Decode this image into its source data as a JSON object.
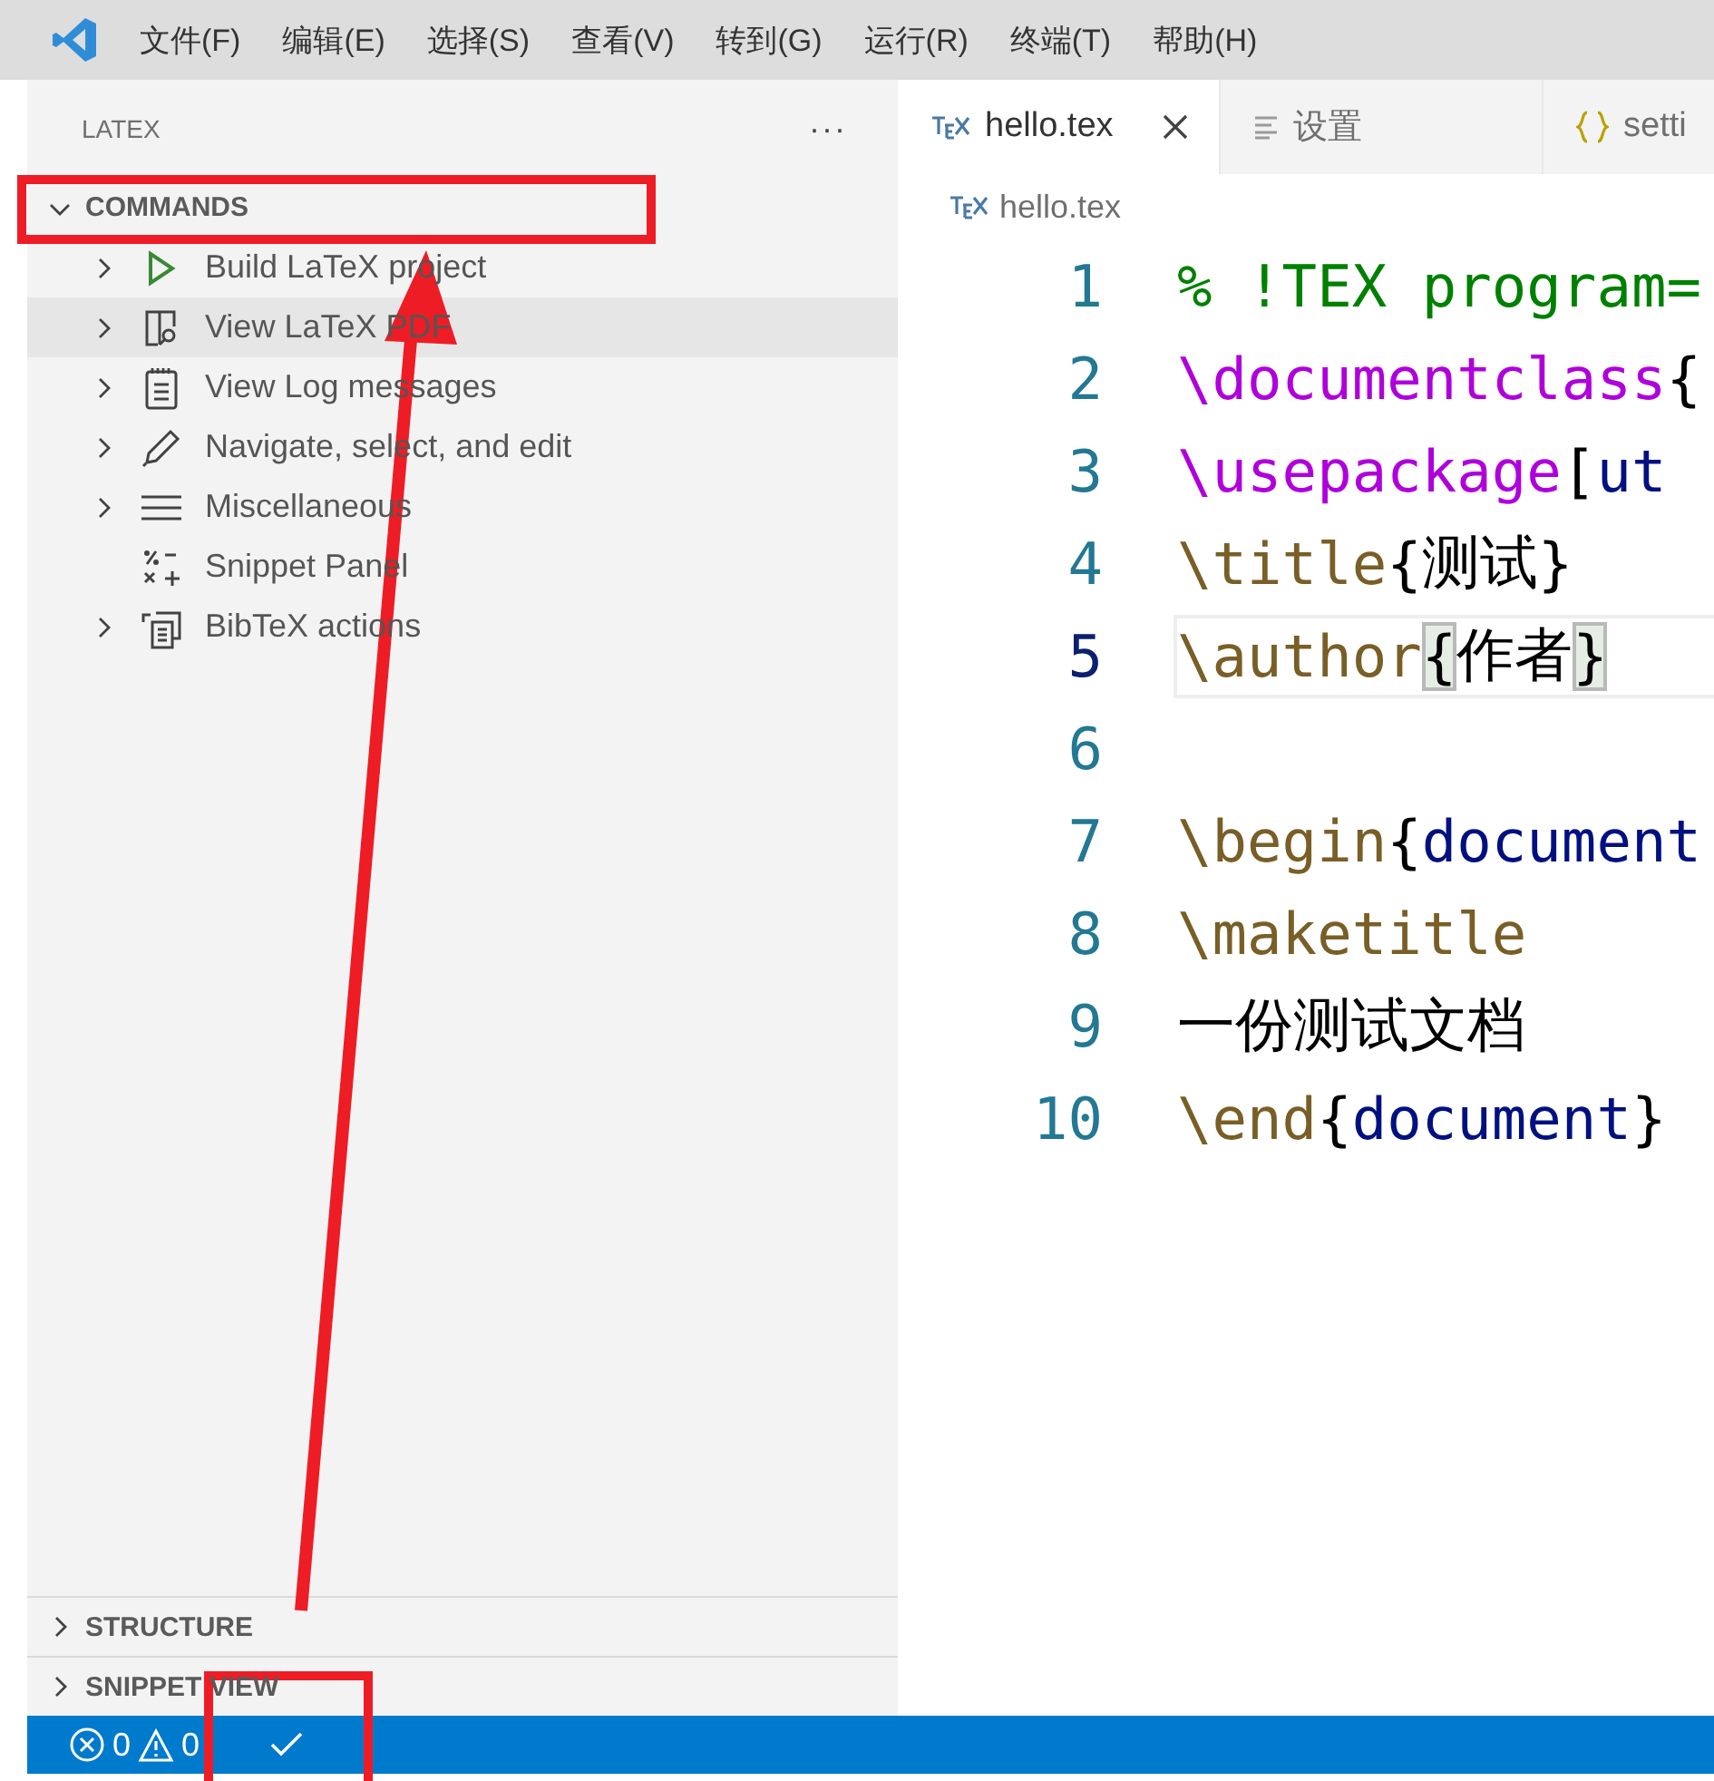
{
  "menu_bar": [
    "文件(F)",
    "编辑(E)",
    "选择(S)",
    "查看(V)",
    "转到(G)",
    "运行(R)",
    "终端(T)",
    "帮助(H)"
  ],
  "sidebar": {
    "title": "LATEX",
    "more": "···",
    "sections": [
      {
        "label": "COMMANDS",
        "expanded": true,
        "items": [
          {
            "label": "Build LaTeX project",
            "kind": "play",
            "expandable": true,
            "selected": false
          },
          {
            "label": "View LaTeX PDF",
            "kind": "pdf",
            "expandable": true,
            "selected": true
          },
          {
            "label": "View Log messages",
            "kind": "log",
            "expandable": true,
            "selected": false
          },
          {
            "label": "Navigate, select, and edit",
            "kind": "pencil",
            "expandable": true,
            "selected": false
          },
          {
            "label": "Miscellaneous",
            "kind": "lines",
            "expandable": true,
            "selected": false
          },
          {
            "label": "Snippet Panel",
            "kind": "symbols",
            "expandable": false,
            "selected": false
          },
          {
            "label": "BibTeX actions",
            "kind": "bib",
            "expandable": true,
            "selected": false
          }
        ]
      },
      {
        "label": "STRUCTURE",
        "expanded": false
      },
      {
        "label": "SNIPPET VIEW",
        "expanded": false
      }
    ]
  },
  "tabs": [
    {
      "label": "hello.tex",
      "kind": "tex",
      "selected": true
    },
    {
      "label": "设置",
      "kind": "settings",
      "selected": false
    },
    {
      "label": "setti",
      "kind": "json",
      "selected": false
    }
  ],
  "breadcrumb": "hello.tex",
  "editor": {
    "lines": [
      {
        "number": "1",
        "current": false,
        "tokens": [
          {
            "text": "% !TEX program=",
            "kind": "comment"
          }
        ]
      },
      {
        "number": "2",
        "current": false,
        "tokens": [
          {
            "text": "\\documentclass",
            "kind": "keyword"
          },
          {
            "text": "{",
            "kind": "bracket"
          }
        ]
      },
      {
        "number": "3",
        "current": false,
        "tokens": [
          {
            "text": "\\usepackage",
            "kind": "keyword"
          },
          {
            "text": "[",
            "kind": "bracket"
          },
          {
            "text": "ut",
            "kind": "argument"
          }
        ]
      },
      {
        "number": "4",
        "current": false,
        "tokens": [
          {
            "text": "\\title",
            "kind": "command"
          },
          {
            "text": "{",
            "kind": "bracket"
          },
          {
            "text": "测试",
            "kind": "plain"
          },
          {
            "text": "}",
            "kind": "bracket"
          }
        ]
      },
      {
        "number": "5",
        "current": true,
        "tokens": [
          {
            "text": "\\author",
            "kind": "command"
          },
          {
            "text": "{",
            "kind": "matched-bracket"
          },
          {
            "text": "作者",
            "kind": "plain"
          },
          {
            "text": "}",
            "kind": "matched-bracket"
          }
        ]
      },
      {
        "number": "6",
        "current": false
      },
      {
        "number": "7",
        "current": false,
        "tokens": [
          {
            "text": "\\begin",
            "kind": "command"
          },
          {
            "text": "{",
            "kind": "bracket"
          },
          {
            "text": "document",
            "kind": "argument"
          }
        ]
      },
      {
        "number": "8",
        "current": false,
        "tokens": [
          {
            "text": "\\maketitle",
            "kind": "command"
          }
        ]
      },
      {
        "number": "9",
        "current": false,
        "tokens": [
          {
            "text": "一份测试文档",
            "kind": "plain"
          }
        ]
      },
      {
        "number": "10",
        "current": false,
        "tokens": [
          {
            "text": "\\end",
            "kind": "command"
          },
          {
            "text": "{",
            "kind": "bracket"
          },
          {
            "text": "document",
            "kind": "argument"
          },
          {
            "text": "}",
            "kind": "bracket"
          }
        ]
      }
    ]
  },
  "status_bar": {
    "errors": "0",
    "warnings": "0"
  }
}
